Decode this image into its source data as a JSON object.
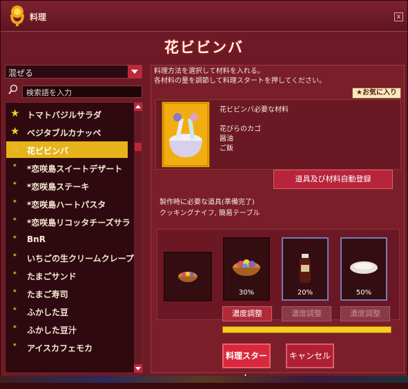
{
  "window": {
    "title": "料理",
    "close_label": "x"
  },
  "recipe": {
    "name": "花ビビンバ"
  },
  "filter": {
    "selected": "混ぜる",
    "search_placeholder": "検索語を入力"
  },
  "recipes": [
    {
      "label": "トマトバジルサラダ",
      "mark": "★"
    },
    {
      "label": "ベジタブルカナッペ",
      "mark": "★"
    },
    {
      "label": "花ビビンバ",
      "mark": "☆"
    },
    {
      "label": "*恋咲島スイートデザート",
      "mark": "*"
    },
    {
      "label": "*恋咲島ステーキ",
      "mark": "*"
    },
    {
      "label": "*恋咲島ハートパスタ",
      "mark": "*"
    },
    {
      "label": "*恋咲島リコッタチーズサラ",
      "mark": "*"
    },
    {
      "label": "BnR",
      "mark": "*"
    },
    {
      "label": "いちごの生クリームクレープ",
      "mark": "*"
    },
    {
      "label": "たまごサンド",
      "mark": "*"
    },
    {
      "label": "たまご寿司",
      "mark": "*"
    },
    {
      "label": "ふかした豆",
      "mark": "*"
    },
    {
      "label": "ふかした豆汁",
      "mark": "*"
    },
    {
      "label": "アイスカフェモカ",
      "mark": "*"
    }
  ],
  "instructions": {
    "line1": "料理方法を選択して材料を入れる。",
    "line2": "各材料の量を調節して料理スタートを押してください。"
  },
  "favorite_label": "★お気に入り",
  "materials": {
    "heading": "花ビビンバ必要な材料",
    "items": [
      "花びらのカゴ",
      "醤油",
      "ご飯"
    ]
  },
  "auto_register_label": "道具及び材料自動登録",
  "tools": {
    "line1": "製作時に必要な道具(準備完了)",
    "line2": "クッキングナイフ, 簡易テーブル"
  },
  "slots": [
    {
      "name": "花びらのカゴ",
      "percent": "30%"
    },
    {
      "name": "醤油",
      "percent": "20%"
    },
    {
      "name": "ご飯",
      "percent": "50%"
    }
  ],
  "adjust_label": "濃度調整",
  "buttons": {
    "start": "料理スタート",
    "cancel": "キャンセル"
  },
  "progress": {
    "fraction": 1.0
  }
}
